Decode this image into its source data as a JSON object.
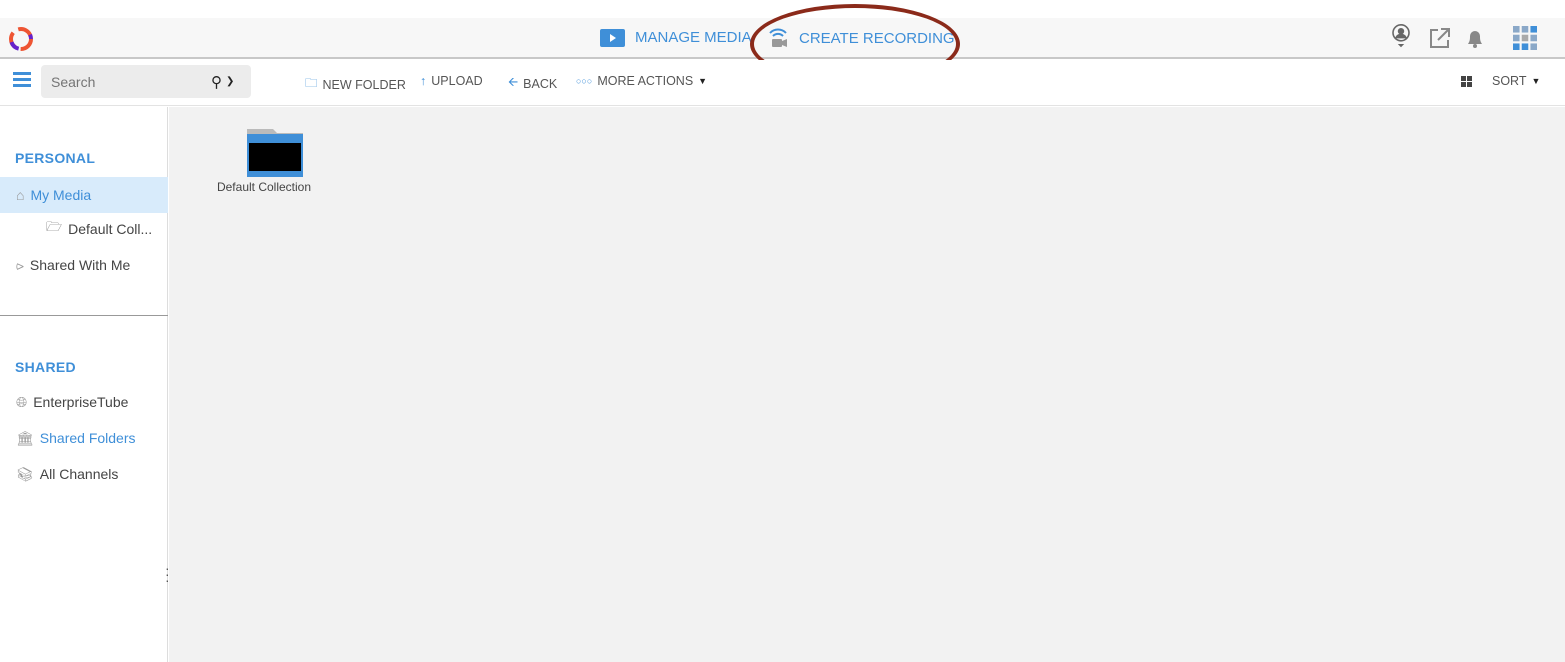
{
  "header": {
    "nav": [
      {
        "label": "MANAGE MEDIA",
        "icon": "media-folder-icon"
      },
      {
        "label": "CREATE RECORDING",
        "icon": "recording-camera-icon"
      }
    ],
    "icons": [
      "user-profile-icon",
      "external-link-icon",
      "bell-icon",
      "apps-grid-icon"
    ]
  },
  "toolbar": {
    "search_placeholder": "Search",
    "new_folder": "NEW FOLDER",
    "upload": "UPLOAD",
    "back": "BACK",
    "more_actions": "MORE ACTIONS",
    "sort": "SORT"
  },
  "sidebar": {
    "personal": "PERSONAL",
    "shared": "SHARED",
    "personal_items": [
      {
        "label": "My Media"
      },
      {
        "label": "Default Coll..."
      },
      {
        "label": "Shared With Me"
      }
    ],
    "shared_items": [
      {
        "label": "EnterpriseTube"
      },
      {
        "label": "Shared Folders"
      },
      {
        "label": "All Channels"
      }
    ]
  },
  "main": {
    "folders": [
      {
        "label": "Default Collection"
      }
    ]
  },
  "colors": {
    "accent": "#3f8fd8",
    "annotation": "#8b2a1a"
  }
}
